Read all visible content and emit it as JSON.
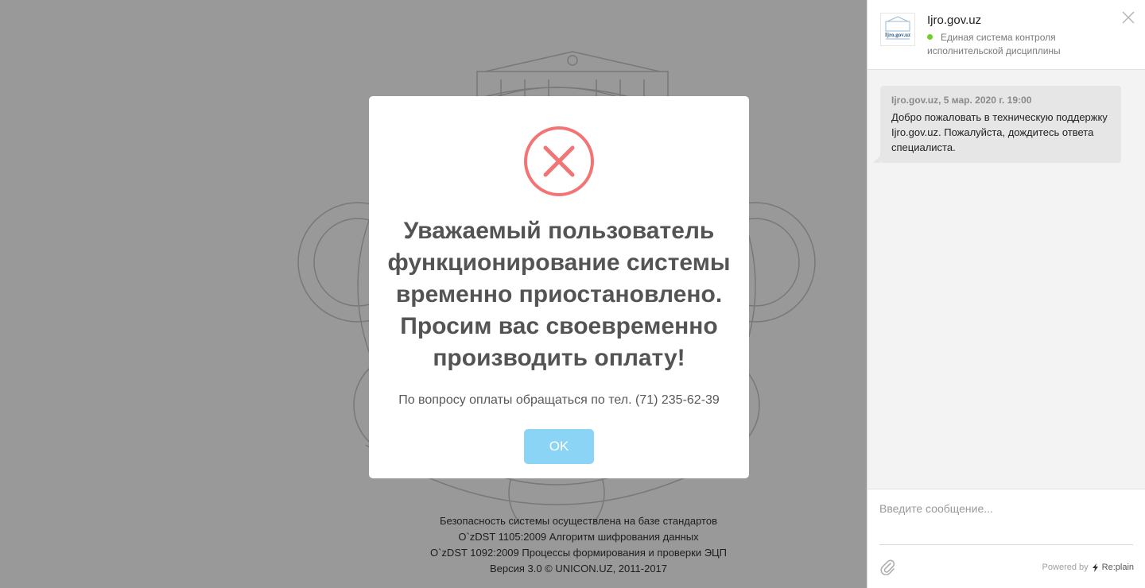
{
  "background": {
    "footer_lines": [
      "Безопасность системы осуществлена на базе стандартов",
      "O`zDST 1105:2009 Алгоритм шифрования данных",
      "O`zDST 1092:2009 Процессы формирования и проверки ЭЦП",
      "Версия 3.0 © UNICON.UZ, 2011-2017"
    ]
  },
  "modal": {
    "icon": "error-x-icon",
    "title": "Уважаемый пользователь функционирование системы временно приостановлено. Просим вас своевременно производить оплату!",
    "text": "По вопросу оплаты обращаться по тел. (71) 235-62-39",
    "ok_label": "OK",
    "colors": {
      "icon": "#f27474",
      "button": "#8cd4f5"
    }
  },
  "chat": {
    "logo_text": "Ijro.gov.uz",
    "title": "Ijro.gov.uz",
    "subtitle": "Единая система контроля исполнительской дисциплины",
    "status_color": "#6fcf2c",
    "messages": [
      {
        "meta": "Ijro.gov.uz, 5 мар. 2020 г. 19:00",
        "text": "Добро пожаловать в техническую поддержку Ijro.gov.uz. Пожалуйста, дождитесь ответа специалиста."
      }
    ],
    "input_placeholder": "Введите сообщение...",
    "powered_by": "Powered by",
    "powered_brand": "Re:plain"
  }
}
